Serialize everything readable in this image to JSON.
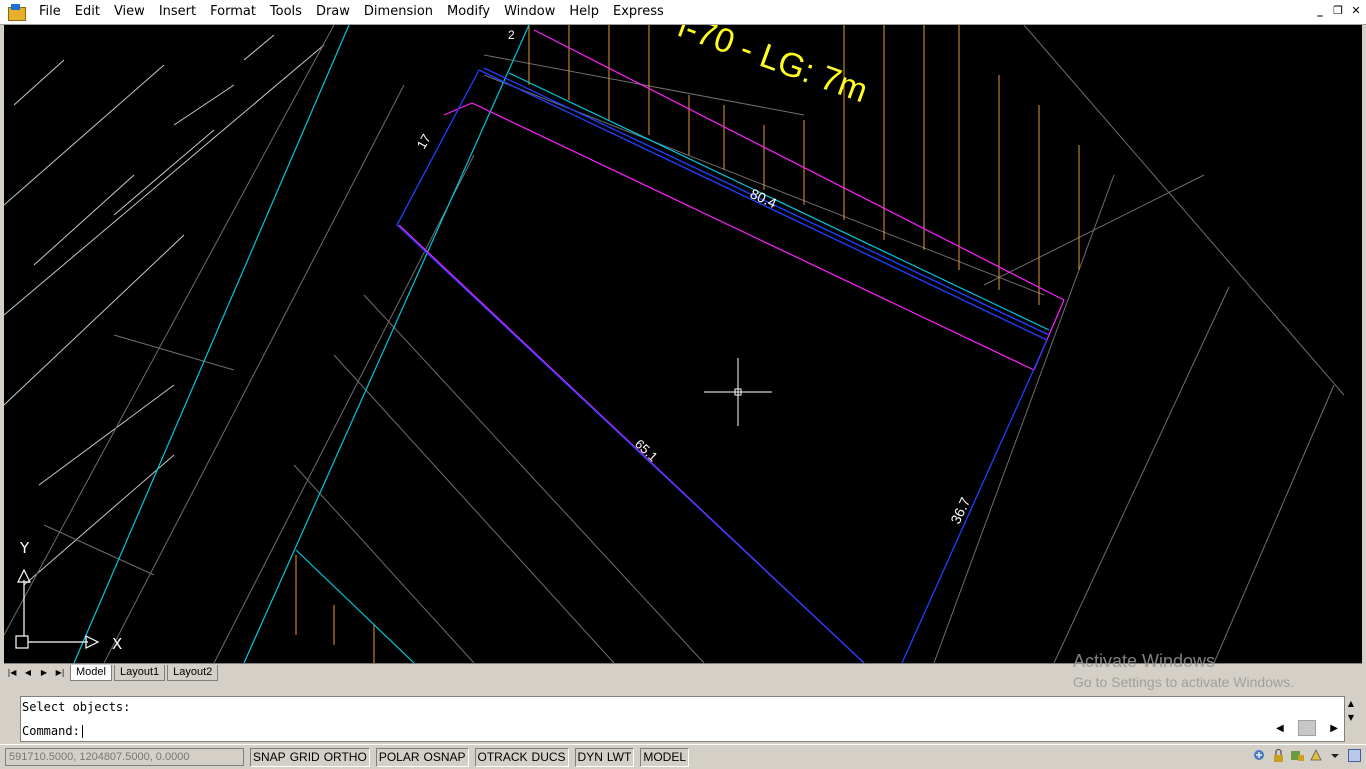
{
  "menu": {
    "items": [
      "File",
      "Edit",
      "View",
      "Insert",
      "Format",
      "Tools",
      "Draw",
      "Dimension",
      "Modify",
      "Window",
      "Help",
      "Express"
    ]
  },
  "window_controls": {
    "minimize": "_",
    "restore": "❐",
    "close": "✕"
  },
  "drawing": {
    "road_label": "l-70 - LG: 7m",
    "dims": {
      "top": "80.4",
      "left": "17",
      "diag": "65.1",
      "right": "36.7",
      "small": "2"
    },
    "ucs": {
      "x_label": "X",
      "y_label": "Y"
    },
    "colors": {
      "background": "#000000",
      "cyan": "#00c8dc",
      "blue": "#2040ff",
      "magenta": "#ff20ff",
      "yellow": "#ffff20",
      "orange": "#e89a2a",
      "white": "#ffffff",
      "grey": "#808080"
    }
  },
  "layout_tabs": {
    "nav": [
      "|◀",
      "◀",
      "▶",
      "▶|"
    ],
    "tabs": [
      "Model",
      "Layout1",
      "Layout2"
    ],
    "active": "Model"
  },
  "command": {
    "line1": "Select objects:",
    "line2": "Command:"
  },
  "status": {
    "coords": "591710.5000, 1204807.5000, 0.0000",
    "group1": [
      "SNAP",
      "GRID",
      "ORTHO"
    ],
    "group2": [
      "POLAR",
      "OSNAP"
    ],
    "group3": [
      "OTRACK",
      "DUCS"
    ],
    "group4": [
      "DYN",
      "LWT"
    ],
    "group5": [
      "MODEL"
    ]
  },
  "watermark": {
    "line1": "Activate Windows",
    "line2": "Go to Settings to activate Windows."
  }
}
